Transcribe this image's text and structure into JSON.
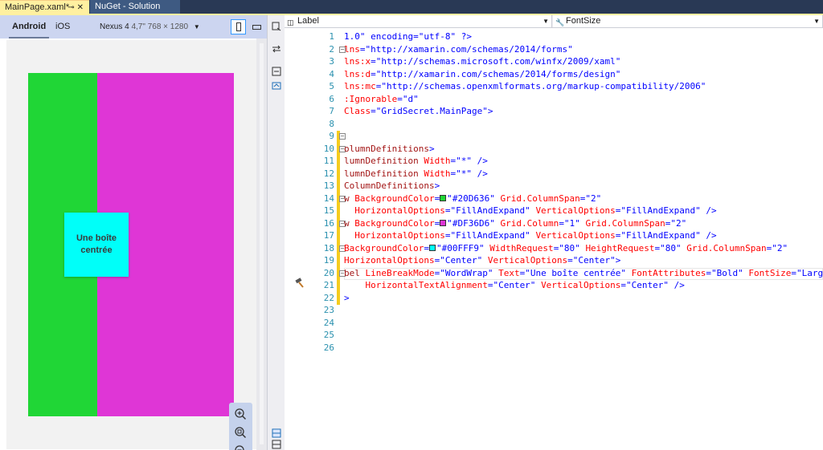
{
  "tabs": [
    {
      "label": "MainPage.xaml*",
      "active": true
    },
    {
      "label": "NuGet - Solution",
      "active": false
    }
  ],
  "previewer": {
    "platforms": [
      "Android",
      "iOS"
    ],
    "device": "Nexus 4",
    "resolution": "4,7\" 768 × 1280",
    "preview": {
      "green": "#20D636",
      "magenta": "#DF36D6",
      "cyan": "#00FFF9",
      "label": "Une boîte centrée"
    }
  },
  "nav": {
    "left": "Label",
    "right": "FontSize"
  },
  "code": [
    {
      "n": "1",
      "segs": [
        [
          "v",
          "1.0\" encoding=\"utf-8\" ?>"
        ]
      ]
    },
    {
      "n": "2",
      "fold": true,
      "segs": [
        [
          "a",
          "lns"
        ],
        [
          "v",
          "=\"http://xamarin.com/schemas/2014/forms\""
        ]
      ]
    },
    {
      "n": "3",
      "segs": [
        [
          "a",
          "lns:x"
        ],
        [
          "v",
          "=\"http://schemas.microsoft.com/winfx/2009/xaml\""
        ]
      ]
    },
    {
      "n": "4",
      "segs": [
        [
          "a",
          "lns:d"
        ],
        [
          "v",
          "=\"http://xamarin.com/schemas/2014/forms/design\""
        ]
      ]
    },
    {
      "n": "5",
      "segs": [
        [
          "a",
          "lns:mc"
        ],
        [
          "v",
          "=\"http://schemas.openxmlformats.org/markup-compatibility/2006\""
        ]
      ]
    },
    {
      "n": "6",
      "segs": [
        [
          "a",
          ":Ignorable"
        ],
        [
          "v",
          "=\"d\""
        ]
      ]
    },
    {
      "n": "7",
      "segs": [
        [
          "a",
          "Class"
        ],
        [
          "v",
          "=\"GridSecret.MainPage\">"
        ]
      ]
    },
    {
      "n": "8",
      "segs": []
    },
    {
      "n": "9",
      "fold": true,
      "mark": true,
      "segs": []
    },
    {
      "n": "10",
      "fold": true,
      "mark": true,
      "segs": [
        [
          "t",
          "olumnDefinitions"
        ],
        [
          "v",
          ">"
        ]
      ]
    },
    {
      "n": "11",
      "mark": true,
      "segs": [
        [
          "t",
          "lumnDefinition "
        ],
        [
          "a",
          "Width"
        ],
        [
          "v",
          "=\"*\" />"
        ]
      ]
    },
    {
      "n": "12",
      "mark": true,
      "segs": [
        [
          "t",
          "lumnDefinition "
        ],
        [
          "a",
          "Width"
        ],
        [
          "v",
          "=\"*\" />"
        ]
      ]
    },
    {
      "n": "13",
      "mark": true,
      "segs": [
        [
          "t",
          "ColumnDefinitions"
        ],
        [
          "v",
          ">"
        ]
      ]
    },
    {
      "n": "14",
      "fold": true,
      "mark": true,
      "segs": [
        [
          "t",
          "w "
        ],
        [
          "a",
          "BackgroundColor"
        ],
        [
          "v",
          "="
        ],
        [
          "sw",
          "#20D636"
        ],
        [
          "v",
          "\"#20D636\" "
        ],
        [
          "a",
          "Grid.ColumnSpan"
        ],
        [
          "v",
          "=\"2\""
        ]
      ]
    },
    {
      "n": "15",
      "mark": true,
      "segs": [
        [
          "v",
          "  "
        ],
        [
          "a",
          "HorizontalOptions"
        ],
        [
          "v",
          "=\"FillAndExpand\" "
        ],
        [
          "a",
          "VerticalOptions"
        ],
        [
          "v",
          "=\"FillAndExpand\" />"
        ]
      ]
    },
    {
      "n": "16",
      "fold": true,
      "mark": true,
      "segs": [
        [
          "t",
          "w "
        ],
        [
          "a",
          "BackgroundColor"
        ],
        [
          "v",
          "="
        ],
        [
          "sw",
          "#DF36D6"
        ],
        [
          "v",
          "\"#DF36D6\" "
        ],
        [
          "a",
          "Grid.Column"
        ],
        [
          "v",
          "=\"1\" "
        ],
        [
          "a",
          "Grid.ColumnSpan"
        ],
        [
          "v",
          "=\"2\""
        ]
      ]
    },
    {
      "n": "17",
      "mark": true,
      "segs": [
        [
          "v",
          "  "
        ],
        [
          "a",
          "HorizontalOptions"
        ],
        [
          "v",
          "=\"FillAndExpand\" "
        ],
        [
          "a",
          "VerticalOptions"
        ],
        [
          "v",
          "=\"FillAndExpand\" />"
        ]
      ]
    },
    {
      "n": "18",
      "fold": true,
      "mark": true,
      "segs": [
        [
          "a",
          "BackgroundColor"
        ],
        [
          "v",
          "="
        ],
        [
          "sw",
          "#00FFF9"
        ],
        [
          "v",
          "\"#00FFF9\" "
        ],
        [
          "a",
          "WidthRequest"
        ],
        [
          "v",
          "=\"80\" "
        ],
        [
          "a",
          "HeightRequest"
        ],
        [
          "v",
          "=\"80\" "
        ],
        [
          "a",
          "Grid.ColumnSpan"
        ],
        [
          "v",
          "=\"2\""
        ]
      ]
    },
    {
      "n": "19",
      "mark": true,
      "segs": [
        [
          "a",
          "HorizontalOptions"
        ],
        [
          "v",
          "=\"Center\" "
        ],
        [
          "a",
          "VerticalOptions"
        ],
        [
          "v",
          "=\"Center\">"
        ]
      ]
    },
    {
      "n": "20",
      "fold": true,
      "mark": true,
      "current": true,
      "segs": [
        [
          "t",
          "bel "
        ],
        [
          "a",
          "LineBreakMode"
        ],
        [
          "v",
          "=\"WordWrap\" "
        ],
        [
          "a",
          "Text"
        ],
        [
          "v",
          "=\"Une boîte centrée\" "
        ],
        [
          "a",
          "FontAttributes"
        ],
        [
          "v",
          "=\"Bold\" "
        ],
        [
          "a",
          "FontSize"
        ],
        [
          "v",
          "=\"Large\""
        ]
      ]
    },
    {
      "n": "21",
      "mark": true,
      "segs": [
        [
          "v",
          "    "
        ],
        [
          "a",
          "HorizontalTextAlignment"
        ],
        [
          "v",
          "=\"Center\" "
        ],
        [
          "a",
          "VerticalOptions"
        ],
        [
          "v",
          "=\"Center\" />"
        ]
      ]
    },
    {
      "n": "22",
      "mark": true,
      "segs": [
        [
          "v",
          ">"
        ]
      ]
    },
    {
      "n": "23",
      "segs": []
    },
    {
      "n": "24",
      "segs": []
    },
    {
      "n": "25",
      "segs": []
    },
    {
      "n": "26",
      "segs": []
    }
  ]
}
